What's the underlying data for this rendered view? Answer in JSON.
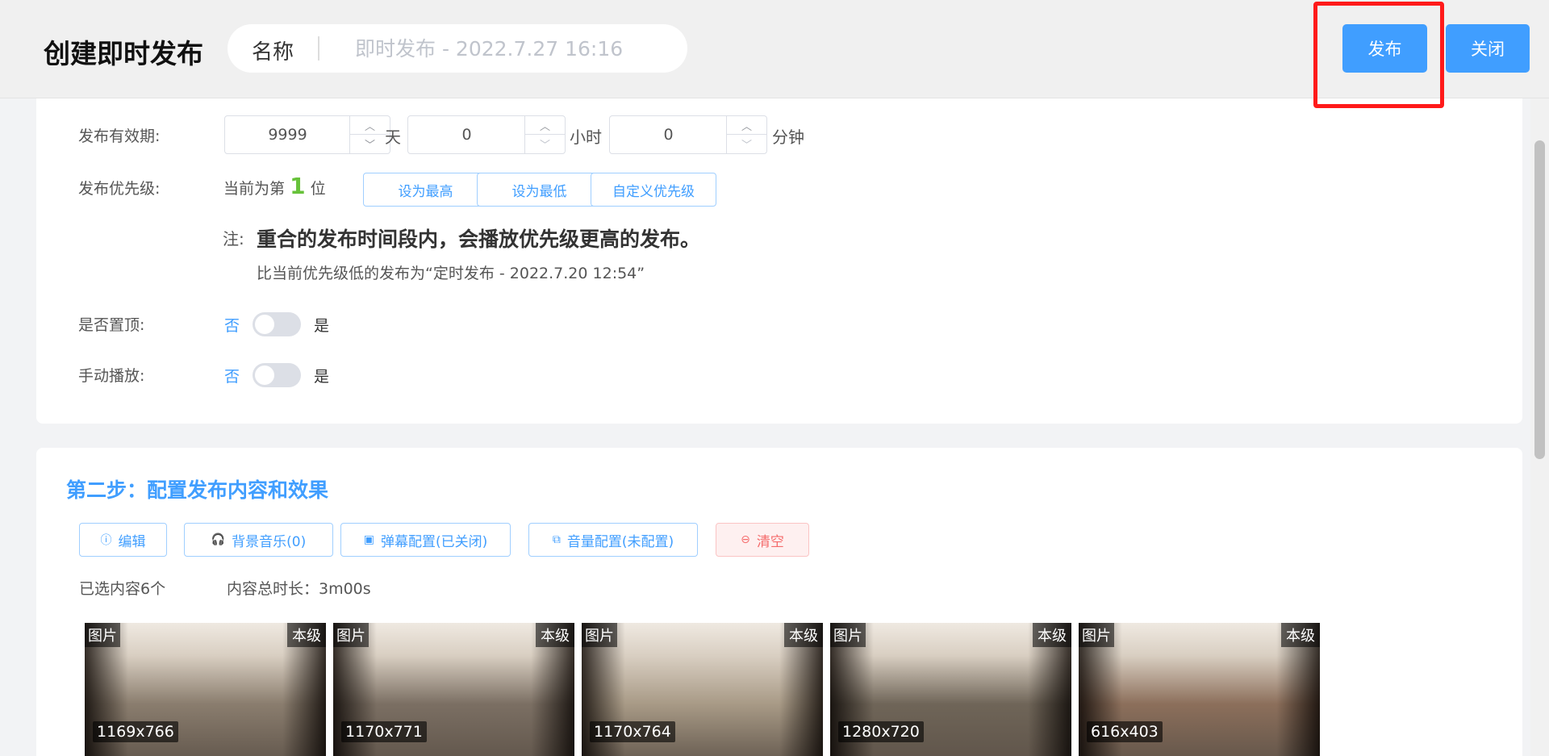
{
  "header": {
    "title": "创建即时发布",
    "name_label": "名称",
    "name_placeholder": "即时发布 - 2022.7.27 16:16",
    "publish_label": "发布",
    "close_label": "关闭"
  },
  "settings": {
    "validity": {
      "label": "发布有效期:",
      "days": "9999",
      "days_unit": "天",
      "hours": "0",
      "hours_unit": "小时",
      "minutes": "0",
      "minutes_unit": "分钟"
    },
    "priority": {
      "label": "发布优先级:",
      "prefix": "当前为第",
      "rank": "1",
      "suffix": "位",
      "btn_highest": "设为最高",
      "btn_lowest": "设为最低",
      "btn_custom": "自定义优先级",
      "note_label": "注:",
      "note_bold": "重合的发布时间段内，会播放优先级更高的发布。",
      "note_sub": "比当前优先级低的发布为“定时发布 - 2022.7.20 12:54”"
    },
    "pin_top": {
      "label": "是否置顶:",
      "off": "否",
      "on": "是"
    },
    "manual_play": {
      "label": "手动播放:",
      "off": "否",
      "on": "是"
    }
  },
  "step2": {
    "title": "第二步：配置发布内容和效果",
    "toolbar": {
      "edit": "编辑",
      "music": "背景音乐(0)",
      "danmaku": "弹幕配置(已关闭)",
      "volume": "音量配置(未配置)",
      "clear": "清空"
    },
    "selected_count": "已选内容6个",
    "total_duration": "内容总时长：3m00s",
    "thumbnails": [
      {
        "type": "图片",
        "level": "本级",
        "size": "1169x766",
        "tone": "#8a7d6e"
      },
      {
        "type": "图片",
        "level": "本级",
        "size": "1170x771",
        "tone": "#7b6f63"
      },
      {
        "type": "图片",
        "level": "本级",
        "size": "1170x764",
        "tone": "#a89a86"
      },
      {
        "type": "图片",
        "level": "本级",
        "size": "1280x720",
        "tone": "#6f6558"
      },
      {
        "type": "图片",
        "level": "本级",
        "size": "616x403",
        "tone": "#8c6f5b"
      }
    ]
  },
  "colors": {
    "primary": "#409eff",
    "highlight": "#ff1a1a",
    "success": "#67c23a",
    "danger": "#f56c6c"
  }
}
